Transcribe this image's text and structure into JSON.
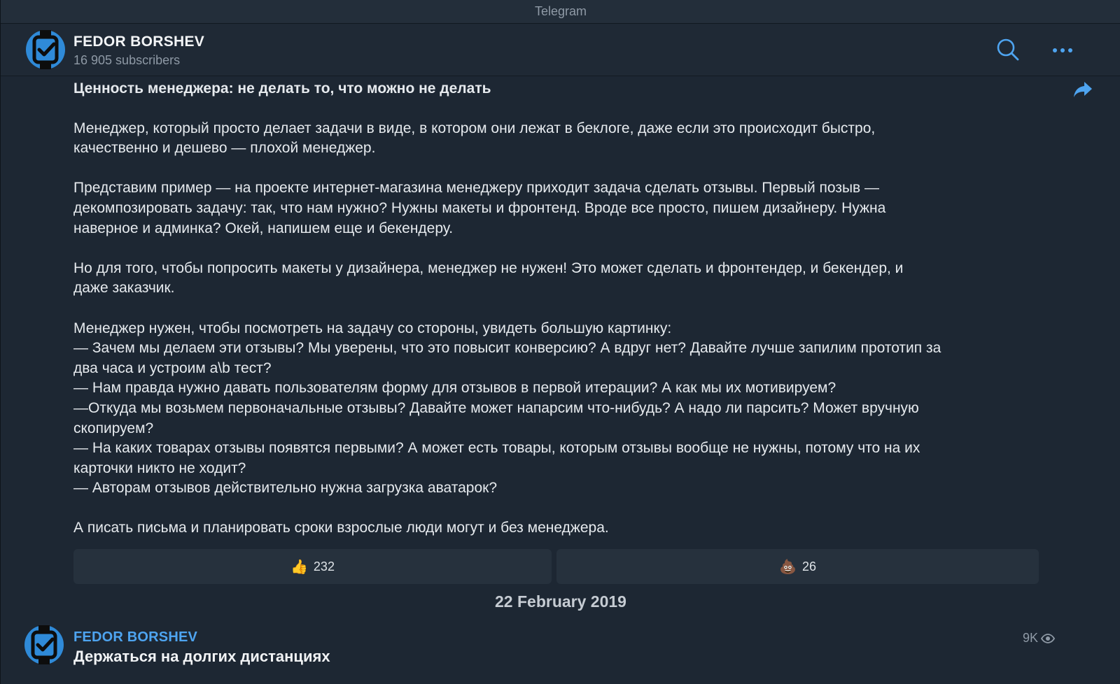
{
  "window": {
    "title": "Telegram"
  },
  "channel": {
    "name": "FEDOR BORSHEV",
    "subscribers": "16 905 subscribers"
  },
  "header": {
    "search_icon": "search-icon",
    "more_icon": "more-dots-icon"
  },
  "message": {
    "title": "Ценность менеджера: не делать то, что можно не делать",
    "paragraphs": [
      "Менеджер, который просто делает задачи в виде, в котором они лежат в беклоге, даже если это происходит быстро,\nкачественно и дешево — плохой менеджер.",
      "Представим пример — на проекте интернет-магазина менеджеру приходит задача сделать отзывы. Первый позыв —\nдекомпозировать задачу: так, что нам нужно? Нужны макеты и фронтенд. Вроде все просто, пишем дизайнеру. Нужна\nнаверное и админка? Окей, напишем еще и бекендеру.",
      "Но для того, чтобы попросить макеты у дизайнера, менеджер не нужен! Это может сделать и фронтендер, и бекендер, и\nдаже заказчик.",
      "Менеджер нужен, чтобы посмотреть на задачу со стороны, увидеть большую картинку:\n— Зачем мы делаем эти отзывы? Мы уверены, что это повысит конверсию? А вдруг нет? Давайте лучше запилим прототип за\nдва часа и устроим a\\b тест?\n— Нам правда нужно давать пользователям форму для отзывов в первой итерации? А как мы их мотивируем?\n—Откуда мы возьмем первоначальные отзывы? Давайте может напарсим что-нибудь? А надо ли парсить? Может вручную\nскопируем?\n— На каких товарах отзывы появятся первыми? А может есть товары, которым отзывы вообще не нужны, потому что на их\nкарточки никто не ходит?\n— Авторам отзывов действительно нужна загрузка аватарок?",
      "А писать письма и планировать сроки взрослые люди могут и без менеджера."
    ],
    "share_icon": "share-arrow-icon",
    "reactions": [
      {
        "emoji": "👍",
        "count": "232"
      },
      {
        "emoji": "💩",
        "count": "26"
      }
    ]
  },
  "date_separator": "22 February 2019",
  "next_post": {
    "author": "FEDOR BORSHEV",
    "title": "Держаться на долгих дистанциях",
    "views": "9K",
    "views_icon": "eye-icon"
  },
  "colors": {
    "background": "#1d2733",
    "accent": "#4ea4f0",
    "avatar": "#2f8ad8"
  }
}
